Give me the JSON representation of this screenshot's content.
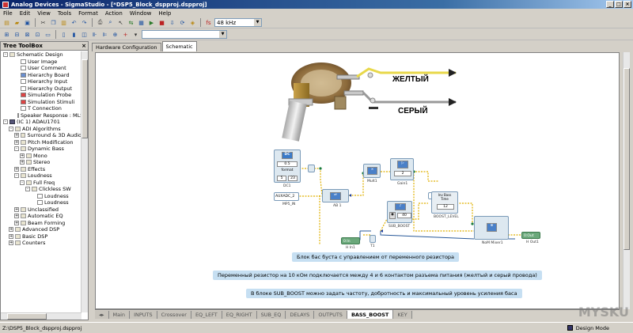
{
  "window": {
    "title_app": "Analog Devices - SigmaStudio - [*DSP5_Block_dspproj.dspproj]"
  },
  "menu": [
    "File",
    "Edit",
    "View",
    "Tools",
    "Format",
    "Action",
    "Window",
    "Help"
  ],
  "toolbar": {
    "sample_rate": "48 kHz"
  },
  "tree": {
    "title": "Tree ToolBox",
    "items": [
      {
        "indent": 0,
        "pm": "-",
        "icon": "fold",
        "label": "Schematic Design"
      },
      {
        "indent": 2,
        "pm": "",
        "icon": "plain",
        "label": "User Image"
      },
      {
        "indent": 2,
        "pm": "",
        "icon": "plain",
        "label": "User Comment"
      },
      {
        "indent": 2,
        "pm": "",
        "icon": "blue",
        "label": "Hierarchy Board"
      },
      {
        "indent": 2,
        "pm": "",
        "icon": "plain",
        "label": "Hierarchy Input"
      },
      {
        "indent": 2,
        "pm": "",
        "icon": "plain",
        "label": "Hierarchy Output"
      },
      {
        "indent": 2,
        "pm": "",
        "icon": "red",
        "label": "Simulation Probe"
      },
      {
        "indent": 2,
        "pm": "",
        "icon": "red",
        "label": "Simulation Stimuli"
      },
      {
        "indent": 2,
        "pm": "",
        "icon": "plain",
        "label": "T Connection"
      },
      {
        "indent": 2,
        "pm": "",
        "icon": "plain",
        "label": "Speaker Response : MLS"
      },
      {
        "indent": 0,
        "pm": "-",
        "icon": "chip",
        "label": "(IC 1) ADAU1701"
      },
      {
        "indent": 1,
        "pm": "-",
        "icon": "fold",
        "label": "ADI Algorithms"
      },
      {
        "indent": 2,
        "pm": "+",
        "icon": "fold",
        "label": "Surround & 3D Audio"
      },
      {
        "indent": 2,
        "pm": "+",
        "icon": "fold",
        "label": "Pitch Modification"
      },
      {
        "indent": 2,
        "pm": "-",
        "icon": "fold",
        "label": "Dynamic Bass"
      },
      {
        "indent": 3,
        "pm": "+",
        "icon": "fold",
        "label": "Mono"
      },
      {
        "indent": 3,
        "pm": "+",
        "icon": "fold",
        "label": "Stereo"
      },
      {
        "indent": 2,
        "pm": "+",
        "icon": "fold",
        "label": "Effects"
      },
      {
        "indent": 2,
        "pm": "-",
        "icon": "fold",
        "label": "Loudness"
      },
      {
        "indent": 3,
        "pm": "-",
        "icon": "fold",
        "label": "Full Freq"
      },
      {
        "indent": 4,
        "pm": "-",
        "icon": "fold",
        "label": "Clickless SW"
      },
      {
        "indent": 5,
        "pm": "",
        "icon": "plain",
        "label": "Loudness"
      },
      {
        "indent": 5,
        "pm": "",
        "icon": "plain",
        "label": "Loudness"
      },
      {
        "indent": 2,
        "pm": "+",
        "icon": "fold",
        "label": "Unclassified"
      },
      {
        "indent": 2,
        "pm": "+",
        "icon": "fold",
        "label": "Automatic EQ"
      },
      {
        "indent": 2,
        "pm": "+",
        "icon": "fold",
        "label": "Beam Forming"
      },
      {
        "indent": 1,
        "pm": "+",
        "icon": "fold",
        "label": "Advanced DSP"
      },
      {
        "indent": 1,
        "pm": "+",
        "icon": "fold",
        "label": "Basic DSP"
      },
      {
        "indent": 1,
        "pm": "+",
        "icon": "fold",
        "label": "Counters"
      }
    ]
  },
  "doc_tabs": [
    "Hardware Configuration",
    "Schematic"
  ],
  "callouts": {
    "yellow": "ЖЕЛТЫЙ",
    "gray": "СЕРЫЙ"
  },
  "banners": [
    "Блок бас буста с управлением от переменного резистора",
    "Переменный резистор на 10 кОм подключается между 4 и 6 контактом разъема питания (желтый и серый провода)",
    "В блоке SUB_BOOST можно задать частоту, добротность и максимальный уровень усиления баса"
  ],
  "blocks": {
    "dc_value": "0.5",
    "dc_format": "format",
    "dc_fmt_a": "5",
    "dc_fmt_b": "23",
    "dc_name": "DC1",
    "aux_select": "AUXADC_2",
    "aux_name": "MP5_IN",
    "ab_name": "AB 1",
    "mult1_name": "Mult1",
    "gain1_value": "2",
    "gain1_name": "Gain1",
    "boost_value": "40",
    "boost_name": "SUB_BOOST",
    "level_header": "Inv Bass",
    "level_sub": "Time",
    "level_value": "12",
    "level_name": "BOOST_LEVEL",
    "in_label": "0:In",
    "in_name": "H In1",
    "t1_name": "T1",
    "mixer_name": "NoM Mixer1",
    "out_label": "0:Out",
    "out_name": "H Out1"
  },
  "sheet_tabs": [
    "Main",
    "INPUTS",
    "Crossover",
    "EQ_LEFT",
    "EQ_RIGHT",
    "SUB_EQ",
    "DELAYS",
    "OUTPUTS",
    "BASS_BOOST",
    "KEY"
  ],
  "active_sheet": "BASS_BOOST",
  "status": {
    "path": "Z:\\DSP5_Block_dspproj.dspproj",
    "mode": "Design Mode"
  },
  "watermark": "MYSKU"
}
